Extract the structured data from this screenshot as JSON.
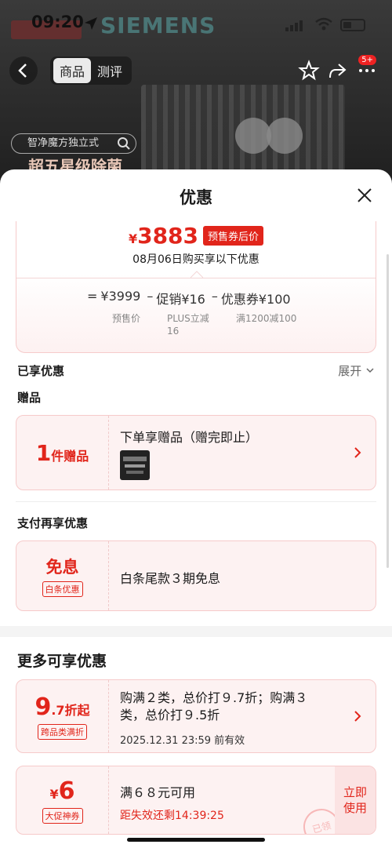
{
  "status": {
    "time": "09:20"
  },
  "background": {
    "brand": "SIEMENS",
    "tag1": "智净魔方独立式",
    "tag2": "超五星级除菌"
  },
  "nav": {
    "tabs": [
      "商品",
      "测评"
    ],
    "badge": "5+"
  },
  "sheet": {
    "title": "优惠",
    "price": {
      "currency": "¥",
      "amount": "3883",
      "tag": "预售券后价",
      "buy_text": "08月06日购买享以下优惠"
    },
    "calc": {
      "eq": "=",
      "base": "¥3999",
      "op1": "–",
      "promo": "促销¥16",
      "op2": "–",
      "coupon": "优惠券¥100",
      "sub_base": "预售价",
      "sub_promo_1": "PLUS立减",
      "sub_promo_2": "16",
      "sub_coupon": "满1200减100"
    },
    "enjoyed_label": "已享优惠",
    "expand_label": "展开",
    "gift_label": "赠品",
    "gift": {
      "count": "1",
      "unit": "件赠品",
      "title": "下单享赠品（赠完即止）"
    },
    "pay_label": "支付再享优惠",
    "pay": {
      "big": "免息",
      "tag": "白条优惠",
      "title": "白条尾款３期免息"
    },
    "more_title": "更多可享优惠",
    "discount": {
      "big": "9",
      "small": ".7折起",
      "tag": "跨品类满折",
      "line1": "购满２类，总价打９.7折；购满３",
      "line2": "类，总价打９.5折",
      "expire": "2025.12.31 23:59 前有效"
    },
    "coupon": {
      "currency": "¥",
      "big": "6",
      "tag": "大促神券",
      "title": "满６８元可用",
      "countdown": "距失效还剩14:39:25",
      "btn_line1": "立即",
      "btn_line2": "使用",
      "stamp": "已领"
    }
  }
}
